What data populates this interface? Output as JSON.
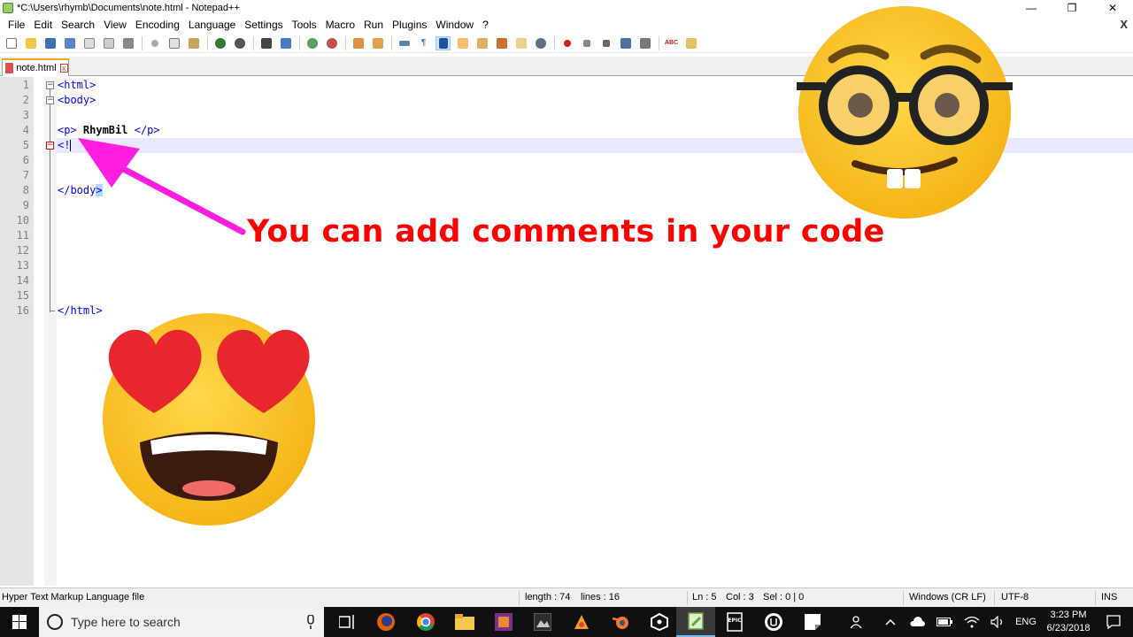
{
  "window": {
    "title": "*C:\\Users\\rhymb\\Documents\\note.html - Notepad++",
    "minimize_glyph": "—",
    "maximize_glyph": "❐",
    "close_glyph": "✕"
  },
  "menu": {
    "items": [
      "File",
      "Edit",
      "Search",
      "View",
      "Encoding",
      "Language",
      "Settings",
      "Tools",
      "Macro",
      "Run",
      "Plugins",
      "Window",
      "?"
    ],
    "close_doc_glyph": "X"
  },
  "tab": {
    "label": "note.html",
    "close_glyph": "x"
  },
  "editor": {
    "lines": [
      {
        "num": "1",
        "parts": [
          [
            "tag",
            "<html>"
          ]
        ]
      },
      {
        "num": "2",
        "parts": [
          [
            "tag",
            "<body>"
          ]
        ]
      },
      {
        "num": "3",
        "parts": []
      },
      {
        "num": "4",
        "parts": [
          [
            "tag",
            "<p>"
          ],
          [
            "txt",
            " RhymBil "
          ],
          [
            "tag",
            "</p>"
          ]
        ]
      },
      {
        "num": "5",
        "parts": [
          [
            "tag",
            "<!"
          ]
        ]
      },
      {
        "num": "6",
        "parts": []
      },
      {
        "num": "7",
        "parts": []
      },
      {
        "num": "8",
        "parts": [
          [
            "tag",
            "</body"
          ],
          [
            "sel",
            ">"
          ]
        ]
      },
      {
        "num": "9",
        "parts": []
      },
      {
        "num": "10",
        "parts": []
      },
      {
        "num": "11",
        "parts": []
      },
      {
        "num": "12",
        "parts": []
      },
      {
        "num": "13",
        "parts": []
      },
      {
        "num": "14",
        "parts": []
      },
      {
        "num": "15",
        "parts": []
      },
      {
        "num": "16",
        "parts": [
          [
            "tag",
            "</html>"
          ]
        ]
      }
    ]
  },
  "overlay": {
    "annotation": "You can add comments in your code",
    "annotation_color": "#ff0000",
    "arrow_color": "#ff1ee0",
    "emoji_top": "nerd-face-emoji",
    "emoji_bottom": "heart-eyes-emoji"
  },
  "status": {
    "file_type": "Hyper Text Markup Language file",
    "length": "length : 74",
    "lines": "lines : 16",
    "ln": "Ln : 5",
    "col": "Col : 3",
    "sel": "Sel : 0 | 0",
    "eol": "Windows (CR LF)",
    "encoding": "UTF-8",
    "mode": "INS"
  },
  "taskbar": {
    "search_placeholder": "Type here to search",
    "language": "ENG",
    "time": "3:23 PM",
    "date": "6/23/2018",
    "epic_label": "EPIC"
  }
}
